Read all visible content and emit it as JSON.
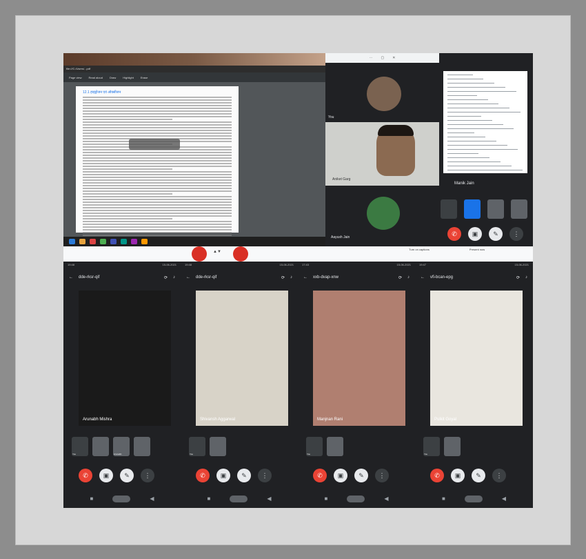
{
  "frame": {
    "outer_bg": "#8d8d8d",
    "inner_bg": "#d7d7d7"
  },
  "share": {
    "url": "file:///C:/Users/...pdf",
    "toolbar": [
      "Page view",
      "Read aloud",
      "Draw",
      "Highlight",
      "Erase"
    ],
    "heading": "12.1 हाइड्रोजन एवं ऑक्सीजन",
    "chip": "Annotate"
  },
  "panel": {
    "header": [
      "⋯",
      "▢",
      "✕"
    ],
    "you_label": "You",
    "user2": "Aniket Garg",
    "user3": "Aayush Jain"
  },
  "phone_top": {
    "name": "Manik Jain"
  },
  "share_bottom": {
    "present": "Turn on captions",
    "captions": "Present now"
  },
  "phones": [
    {
      "time": "19:48",
      "date": "15-06-2021",
      "code": "dde-rksr-qif",
      "name": "Arunabh Mishra",
      "thumbs": [
        {
          "label": "You"
        },
        {
          "label": ""
        },
        {
          "label": "Arunabh"
        },
        {
          "label": ""
        }
      ],
      "video_bg": "#1a1a1a"
    },
    {
      "time": "19:48",
      "date": "15-06-2021",
      "code": "dde-rksr-qif",
      "name": "Shivansh Aggarwal",
      "thumbs": [
        {
          "label": "You"
        },
        {
          "label": ""
        }
      ],
      "video_bg": "#d8d3c8"
    },
    {
      "time": "17:43",
      "date": "15-06-2021",
      "code": "xxb-dvap-xnw",
      "name": "Manjnan Rani",
      "thumbs": [
        {
          "label": "You"
        },
        {
          "label": ""
        }
      ],
      "video_bg": "#b07f70"
    },
    {
      "time": "19:47",
      "date": "15-06-2021",
      "code": "vfi-bcan-epg",
      "name": "Pulkit Goyal",
      "thumbs": [
        {
          "label": "You"
        },
        {
          "label": ""
        }
      ],
      "video_bg": "#e9e6df"
    }
  ]
}
